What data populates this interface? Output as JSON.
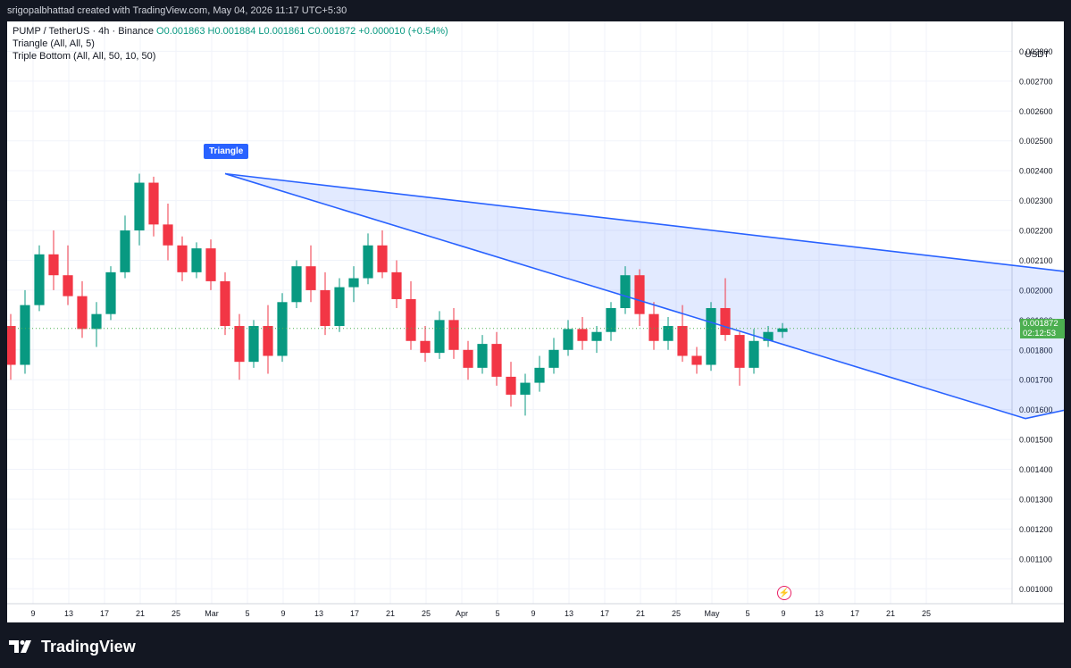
{
  "header": {
    "credit": "srigopalbhattad created with TradingView.com, May 04, 2026 11:17 UTC+5:30"
  },
  "legend": {
    "symbol": "PUMP / TetherUS · 4h · Binance",
    "open": "O0.001863",
    "high": "H0.001884",
    "low": "L0.001861",
    "close": "C0.001872",
    "change": "+0.000010 (+0.54%)",
    "indicator1": "Triangle (All, All, 5)",
    "indicator2": "Triple Bottom (All, All, 50, 10, 50)"
  },
  "price_axis": {
    "currency": "USDT",
    "last_price": "0.001872",
    "countdown": "02:12:53"
  },
  "pattern_label": "Triangle",
  "brand": "TradingView",
  "colors": {
    "up": "#089981",
    "down": "#f23645",
    "pattern": "#2962ff",
    "pattern_fill": "#2962ff22",
    "last_price": "#4caf50"
  },
  "chart_data": {
    "type": "candlestick",
    "ylim": [
      0.00095,
      0.0029
    ],
    "yticks": [
      "0.002800",
      "0.002700",
      "0.002600",
      "0.002500",
      "0.002400",
      "0.002300",
      "0.002200",
      "0.002100",
      "0.002000",
      "0.001900",
      "0.001800",
      "0.001700",
      "0.001600",
      "0.001500",
      "0.001400",
      "0.001300",
      "0.001200",
      "0.001100",
      "0.001000"
    ],
    "xticks": [
      "9",
      "13",
      "17",
      "21",
      "25",
      "Mar",
      "5",
      "9",
      "13",
      "17",
      "21",
      "25",
      "Apr",
      "5",
      "9",
      "13",
      "17",
      "21",
      "25",
      "May",
      "5",
      "9",
      "13",
      "17",
      "21",
      "25"
    ],
    "series": [
      {
        "values": [
          [
            0.00188,
            0.00192,
            0.0017,
            0.00175
          ],
          [
            0.00175,
            0.002,
            0.00172,
            0.00195
          ],
          [
            0.00195,
            0.00215,
            0.00193,
            0.00212
          ],
          [
            0.00212,
            0.0022,
            0.002,
            0.00205
          ],
          [
            0.00205,
            0.00215,
            0.00195,
            0.00198
          ],
          [
            0.00198,
            0.00203,
            0.00184,
            0.00187
          ],
          [
            0.00187,
            0.00196,
            0.00181,
            0.00192
          ],
          [
            0.00192,
            0.00208,
            0.0019,
            0.00206
          ],
          [
            0.00206,
            0.00225,
            0.00204,
            0.0022
          ],
          [
            0.0022,
            0.00239,
            0.00215,
            0.00236
          ],
          [
            0.00236,
            0.00238,
            0.00218,
            0.00222
          ],
          [
            0.00222,
            0.00229,
            0.0021,
            0.00215
          ],
          [
            0.00215,
            0.00218,
            0.00203,
            0.00206
          ],
          [
            0.00206,
            0.00216,
            0.00204,
            0.00214
          ],
          [
            0.00214,
            0.00217,
            0.002,
            0.00203
          ],
          [
            0.00203,
            0.00206,
            0.00185,
            0.00188
          ],
          [
            0.00188,
            0.00192,
            0.0017,
            0.00176
          ],
          [
            0.00176,
            0.0019,
            0.00174,
            0.00188
          ],
          [
            0.00188,
            0.00195,
            0.00172,
            0.00178
          ],
          [
            0.00178,
            0.00199,
            0.00176,
            0.00196
          ],
          [
            0.00196,
            0.0021,
            0.00194,
            0.00208
          ],
          [
            0.00208,
            0.00215,
            0.00196,
            0.002
          ],
          [
            0.002,
            0.00206,
            0.00185,
            0.00188
          ],
          [
            0.00188,
            0.00204,
            0.00186,
            0.00201
          ],
          [
            0.00201,
            0.00208,
            0.00196,
            0.00204
          ],
          [
            0.00204,
            0.00219,
            0.00202,
            0.00215
          ],
          [
            0.00215,
            0.0022,
            0.00204,
            0.00206
          ],
          [
            0.00206,
            0.0021,
            0.00194,
            0.00197
          ],
          [
            0.00197,
            0.00203,
            0.0018,
            0.00183
          ],
          [
            0.00183,
            0.00188,
            0.00176,
            0.00179
          ],
          [
            0.00179,
            0.00193,
            0.00177,
            0.0019
          ],
          [
            0.0019,
            0.00194,
            0.00177,
            0.0018
          ],
          [
            0.0018,
            0.00183,
            0.0017,
            0.00174
          ],
          [
            0.00174,
            0.00185,
            0.00172,
            0.00182
          ],
          [
            0.00182,
            0.00186,
            0.00168,
            0.00171
          ],
          [
            0.00171,
            0.00176,
            0.00161,
            0.00165
          ],
          [
            0.00165,
            0.00172,
            0.00158,
            0.00169
          ],
          [
            0.00169,
            0.00178,
            0.00166,
            0.00174
          ],
          [
            0.00174,
            0.00184,
            0.00172,
            0.0018
          ],
          [
            0.0018,
            0.0019,
            0.00178,
            0.00187
          ],
          [
            0.00187,
            0.00191,
            0.0018,
            0.00183
          ],
          [
            0.00183,
            0.00188,
            0.00179,
            0.00186
          ],
          [
            0.00186,
            0.00196,
            0.00183,
            0.00194
          ],
          [
            0.00194,
            0.00208,
            0.00192,
            0.00205
          ],
          [
            0.00205,
            0.00207,
            0.00188,
            0.00192
          ],
          [
            0.00192,
            0.00196,
            0.0018,
            0.00183
          ],
          [
            0.00183,
            0.00191,
            0.0018,
            0.00188
          ],
          [
            0.00188,
            0.00195,
            0.00176,
            0.00178
          ],
          [
            0.00178,
            0.00181,
            0.00172,
            0.00175
          ],
          [
            0.00175,
            0.00196,
            0.00173,
            0.00194
          ],
          [
            0.00194,
            0.00204,
            0.00183,
            0.00185
          ],
          [
            0.00185,
            0.00186,
            0.00168,
            0.00174
          ],
          [
            0.00174,
            0.00187,
            0.00172,
            0.00183
          ],
          [
            0.00183,
            0.00188,
            0.00181,
            0.00186
          ],
          [
            0.00186,
            0.00189,
            0.00184,
            0.001872
          ]
        ]
      },
      {
        "name": "Triangle",
        "points": [
          [
            15,
            0.00239
          ],
          [
            103,
            0.0019
          ],
          [
            71,
            0.00157
          ],
          [
            15,
            0.00239
          ],
          [
            71,
            0.00157
          ],
          [
            103,
            0.0019
          ]
        ]
      }
    ]
  }
}
